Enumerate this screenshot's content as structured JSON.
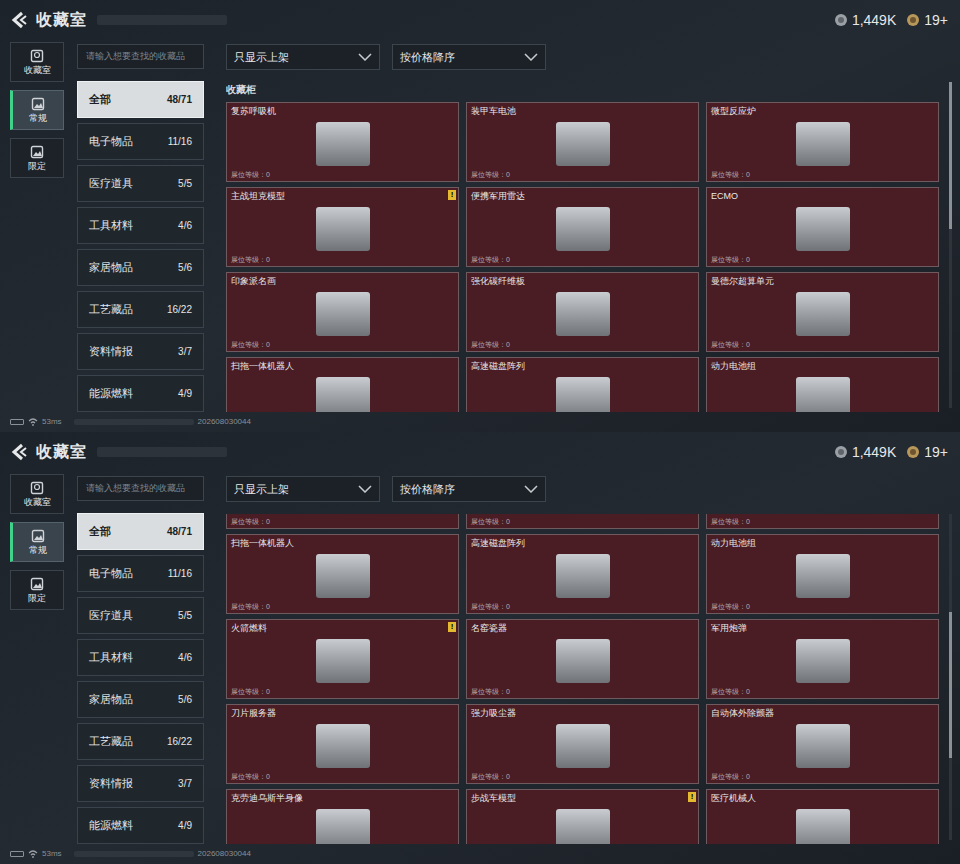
{
  "alert_mark": "!",
  "screens": [
    {
      "header": {
        "title": "收藏室",
        "currencies": [
          {
            "value": "1,449K",
            "kind": "coin"
          },
          {
            "value": "19+",
            "kind": "ticket"
          }
        ]
      },
      "nav_tabs": [
        {
          "label": "收藏室",
          "selected": false
        },
        {
          "label": "常规",
          "selected": true
        },
        {
          "label": "限定",
          "selected": false
        }
      ],
      "search": {
        "placeholder": "请输入想要查找的收藏品"
      },
      "filters": [
        "只显示上架",
        "按价格降序"
      ],
      "categories": [
        {
          "name": "全部",
          "count": "48/71",
          "selected": true
        },
        {
          "name": "电子物品",
          "count": "11/16",
          "selected": false
        },
        {
          "name": "医疗道具",
          "count": "5/5",
          "selected": false
        },
        {
          "name": "工具材料",
          "count": "4/6",
          "selected": false
        },
        {
          "name": "家居物品",
          "count": "5/6",
          "selected": false
        },
        {
          "name": "工艺藏品",
          "count": "16/22",
          "selected": false
        },
        {
          "name": "资料情报",
          "count": "3/7",
          "selected": false
        },
        {
          "name": "能源燃料",
          "count": "4/9",
          "selected": false
        }
      ],
      "cabinet_label": "收藏柜",
      "partial_top_levels": [],
      "scroll_position": 0,
      "cards": [
        {
          "name": "复苏呼吸机",
          "level": "展位等级：0",
          "alert": false
        },
        {
          "name": "装甲车电池",
          "level": "展位等级：0",
          "alert": false
        },
        {
          "name": "微型反应炉",
          "level": "展位等级：0",
          "alert": false
        },
        {
          "name": "主战坦克模型",
          "level": "展位等级：0",
          "alert": true
        },
        {
          "name": "便携军用雷达",
          "level": "展位等级：0",
          "alert": false
        },
        {
          "name": "ECMO",
          "level": "展位等级：0",
          "alert": false
        },
        {
          "name": "印象派名画",
          "level": "展位等级：0",
          "alert": false
        },
        {
          "name": "强化碳纤维板",
          "level": "展位等级：0",
          "alert": false
        },
        {
          "name": "曼德尔超算单元",
          "level": "展位等级：0",
          "alert": false
        },
        {
          "name": "扫拖一体机器人",
          "level": "",
          "alert": false
        },
        {
          "name": "高速磁盘阵列",
          "level": "",
          "alert": false
        },
        {
          "name": "动力电池组",
          "level": "",
          "alert": false
        }
      ],
      "status_bar": {
        "ping": "53ms",
        "build": "202608030044"
      }
    },
    {
      "header": {
        "title": "收藏室",
        "currencies": [
          {
            "value": "1,449K",
            "kind": "coin"
          },
          {
            "value": "19+",
            "kind": "ticket"
          }
        ]
      },
      "nav_tabs": [
        {
          "label": "收藏室",
          "selected": false
        },
        {
          "label": "常规",
          "selected": true
        },
        {
          "label": "限定",
          "selected": false
        }
      ],
      "search": {
        "placeholder": "请输入想要查找的收藏品"
      },
      "filters": [
        "只显示上架",
        "按价格降序"
      ],
      "categories": [
        {
          "name": "全部",
          "count": "48/71",
          "selected": true
        },
        {
          "name": "电子物品",
          "count": "11/16",
          "selected": false
        },
        {
          "name": "医疗道具",
          "count": "5/5",
          "selected": false
        },
        {
          "name": "工具材料",
          "count": "4/6",
          "selected": false
        },
        {
          "name": "家居物品",
          "count": "5/6",
          "selected": false
        },
        {
          "name": "工艺藏品",
          "count": "16/22",
          "selected": false
        },
        {
          "name": "资料情报",
          "count": "3/7",
          "selected": false
        },
        {
          "name": "能源燃料",
          "count": "4/9",
          "selected": false
        }
      ],
      "cabinet_label": "",
      "partial_top_levels": [
        "展位等级：0",
        "展位等级：0",
        "展位等级：0"
      ],
      "scroll_position": 0.3,
      "cards": [
        {
          "name": "扫拖一体机器人",
          "level": "展位等级：0",
          "alert": false
        },
        {
          "name": "高速磁盘阵列",
          "level": "展位等级：0",
          "alert": false
        },
        {
          "name": "动力电池组",
          "level": "展位等级：0",
          "alert": false
        },
        {
          "name": "火箭燃料",
          "level": "展位等级：0",
          "alert": true
        },
        {
          "name": "名窑瓷器",
          "level": "展位等级：0",
          "alert": false
        },
        {
          "name": "军用炮弹",
          "level": "展位等级：0",
          "alert": false
        },
        {
          "name": "刀片服务器",
          "level": "展位等级：0",
          "alert": false
        },
        {
          "name": "强力吸尘器",
          "level": "展位等级：0",
          "alert": false
        },
        {
          "name": "自动体外除颤器",
          "level": "展位等级：0",
          "alert": false
        },
        {
          "name": "克劳迪乌斯半身像",
          "level": "",
          "alert": false
        },
        {
          "name": "步战车模型",
          "level": "",
          "alert": true
        },
        {
          "name": "医疗机械人",
          "level": "",
          "alert": false
        }
      ],
      "status_bar": {
        "ping": "53ms",
        "build": "202608030044"
      }
    }
  ]
}
